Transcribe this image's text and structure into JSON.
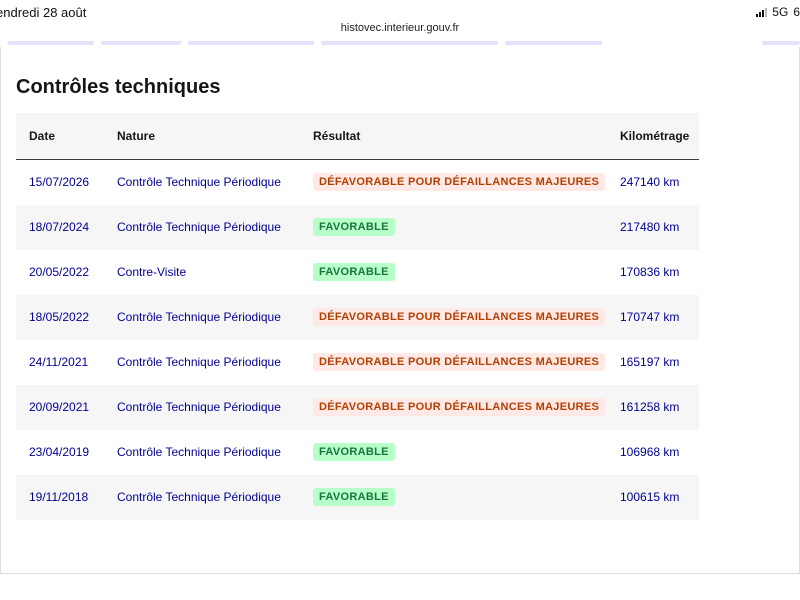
{
  "status_bar": {
    "date": "endredi 28 août",
    "network": "5G",
    "battery": "6"
  },
  "browser": {
    "url": "histovec.interieur.gouv.fr"
  },
  "section": {
    "title": "Contrôles techniques"
  },
  "table": {
    "headers": {
      "date": "Date",
      "nature": "Nature",
      "result": "Résultat",
      "mileage": "Kilométrage"
    },
    "rows": [
      {
        "date": "15/07/2026",
        "nature": "Contrôle Technique Périodique",
        "result": "DÉFAVORABLE POUR DÉFAILLANCES MAJEURES",
        "status": "unfavorable",
        "mileage": "247140 km"
      },
      {
        "date": "18/07/2024",
        "nature": "Contrôle Technique Périodique",
        "result": "FAVORABLE",
        "status": "favorable",
        "mileage": "217480 km"
      },
      {
        "date": "20/05/2022",
        "nature": "Contre-Visite",
        "result": "FAVORABLE",
        "status": "favorable",
        "mileage": "170836 km"
      },
      {
        "date": "18/05/2022",
        "nature": "Contrôle Technique Périodique",
        "result": "DÉFAVORABLE POUR DÉFAILLANCES MAJEURES",
        "status": "unfavorable",
        "mileage": "170747 km"
      },
      {
        "date": "24/11/2021",
        "nature": "Contrôle Technique Périodique",
        "result": "DÉFAVORABLE POUR DÉFAILLANCES MAJEURES",
        "status": "unfavorable",
        "mileage": "165197 km"
      },
      {
        "date": "20/09/2021",
        "nature": "Contrôle Technique Périodique",
        "result": "DÉFAVORABLE POUR DÉFAILLANCES MAJEURES",
        "status": "unfavorable",
        "mileage": "161258 km"
      },
      {
        "date": "23/04/2019",
        "nature": "Contrôle Technique Périodique",
        "result": "FAVORABLE",
        "status": "favorable",
        "mileage": "106968 km"
      },
      {
        "date": "19/11/2018",
        "nature": "Contrôle Technique Périodique",
        "result": "FAVORABLE",
        "status": "favorable",
        "mileage": "100615 km"
      }
    ]
  },
  "colors": {
    "link_blue": "#000091",
    "unfavorable_bg": "#ffe9e6",
    "unfavorable_text": "#b34000",
    "favorable_bg": "#b8fec9",
    "favorable_text": "#18753c",
    "row_alt_bg": "#f6f6f6"
  }
}
